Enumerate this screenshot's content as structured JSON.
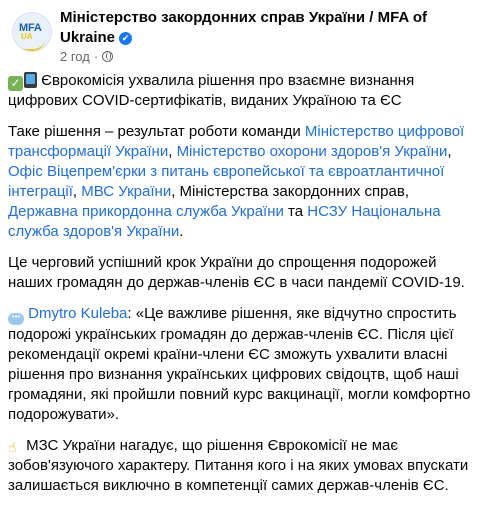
{
  "header": {
    "page_name": "Міністерство закордонних справ України / MFA of Ukraine",
    "logo_text": "MFA",
    "logo_sub": "UA",
    "time": "2 год",
    "dot": "·"
  },
  "post": {
    "p1": {
      "text": "Єврокомісія ухвалила рішення про взаємне визнання цифрових COVID-сертифікатів, виданих Україною та ЄС"
    },
    "p2": {
      "t1": "Таке рішення – результат роботи команди ",
      "l1": "Міністерство цифрової трансформації України",
      "s1": ", ",
      "l2": "Міністерство охорони здоров'я України",
      "s2": ", ",
      "l3": "Офіс Віцепрем'єрки з питань європейської та євроатлантичної інтеграції",
      "s3": ", ",
      "l4": "МВС України",
      "t2": ", Міністерства закордонних справ, ",
      "l5": "Державна прикордонна служба України",
      "t3": " та ",
      "l6": "НСЗУ Національна служба здоров'я України",
      "t4": "."
    },
    "p3": {
      "text": "Це черговий успішний крок України до спрощення подорожей наших громадян до держав-членів ЄС в часи пандемії COVID-19."
    },
    "p4": {
      "link": "Dmytro Kuleba",
      "text": ": «Це важливе рішення, яке відчутно спростить подорожі українських громадян до держав-членів ЄС. Після цієї рекомендації окремі країни-члени ЄС зможуть ухвалити власні рішення про визнання українських цифрових свідоцтв, щоб наші громадяни, які пройшли повний курс вакцинації, могли комфортно подорожувати»."
    },
    "p5": {
      "text": "МЗС України нагадує, що рішення Єврокомісії не має зобов'язуючого характеру. Питання кого і на яких умовах впускати залишається виключно в компетенції самих держав-членів ЄС."
    }
  },
  "icons": {
    "verified": "verified-badge-icon",
    "globe": "globe-icon",
    "check": "check-mark-button-emoji-icon",
    "phone": "mobile-phone-emoji-icon",
    "speech": "speech-balloon-emoji-icon",
    "point": "backhand-index-pointing-up-emoji-icon"
  },
  "colors": {
    "link": "#216fdb",
    "meta": "#65676b",
    "text": "#050505",
    "verified": "#1877f2"
  }
}
